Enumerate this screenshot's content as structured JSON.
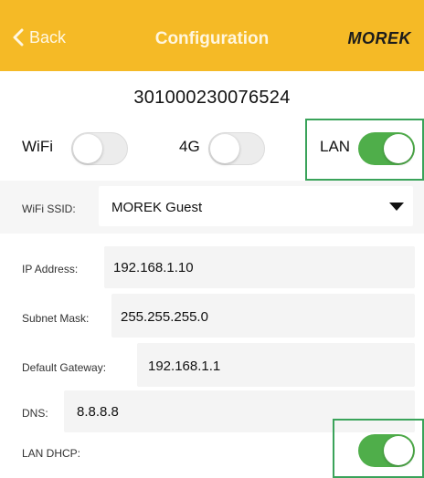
{
  "header": {
    "back_label": "Back",
    "title": "Configuration",
    "brand": "MOREK",
    "color": "#f5ba26"
  },
  "device": {
    "serial": "301000230076524"
  },
  "connection": {
    "wifi_label": "WiFi",
    "wifi_on": false,
    "g4_label": "4G",
    "g4_on": false,
    "lan_label": "LAN",
    "lan_on": true,
    "on_color": "#4fae4a"
  },
  "wifi_ssid": {
    "label": "WiFi SSID:",
    "value": "MOREK Guest"
  },
  "network": {
    "ip_label": "IP Address:",
    "ip_value": "192.168.1.10",
    "subnet_label": "Subnet Mask:",
    "subnet_value": "255.255.255.0",
    "gateway_label": "Default Gateway:",
    "gateway_value": "192.168.1.1",
    "dns_label": "DNS:",
    "dns_value": "8.8.8.8",
    "dhcp_label": "LAN DHCP:",
    "dhcp_on": true
  },
  "highlight_color": "#3aa35a"
}
